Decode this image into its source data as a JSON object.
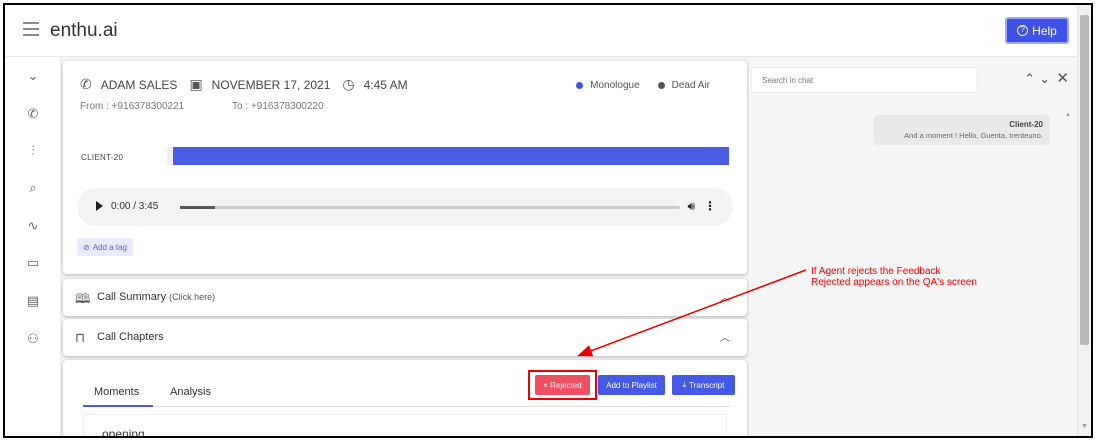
{
  "header": {
    "brand": "enthu.ai",
    "help_label": "Help"
  },
  "call": {
    "agent": "ADAM SALES",
    "date": "NOVEMBER 17, 2021",
    "time": "4:45 AM",
    "from": "From : +916378300221",
    "to": "To : +916378300220",
    "legend": [
      {
        "label": "Monologue",
        "color": "#3f51e6"
      },
      {
        "label": "Dead Air",
        "color": "#555555"
      }
    ],
    "speaker_label": "CLIENT-20",
    "audio": {
      "time": "0:00 / 3:45",
      "progress": 0.07
    },
    "tag_label": "Add a tag"
  },
  "accordions": {
    "summary_title": "Call Summary",
    "summary_hint": "(Click here)",
    "chapters_title": "Call Chapters"
  },
  "moments": {
    "tabs": [
      "Moments",
      "Analysis"
    ],
    "rejected_label": "× Rejected",
    "playlist_label": "Add to Playlist",
    "transcript_label": "Transcript",
    "first_moment": "opening"
  },
  "chat": {
    "search_placeholder": "Search in chat",
    "speaker": "Client-20",
    "message": "And a moment ! Hello, Guenta, trenteuno."
  },
  "annotation": {
    "text": "If Agent rejects the Feedback Rejected appears on the QA's screen",
    "color": "#e00000"
  }
}
